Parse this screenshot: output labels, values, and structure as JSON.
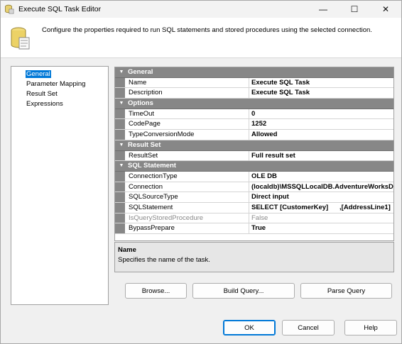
{
  "window": {
    "title": "Execute SQL Task Editor",
    "controls": {
      "minimize": "—",
      "maximize": "☐",
      "close": "✕"
    }
  },
  "header": {
    "description": "Configure the properties required to run SQL statements and stored procedures using the selected connection."
  },
  "nav": {
    "items": [
      {
        "label": "General",
        "selected": true
      },
      {
        "label": "Parameter Mapping",
        "selected": false
      },
      {
        "label": "Result Set",
        "selected": false
      },
      {
        "label": "Expressions",
        "selected": false
      }
    ]
  },
  "grid": {
    "general": {
      "category": "General",
      "name_label": "Name",
      "name_value": "Execute SQL Task",
      "description_label": "Description",
      "description_value": "Execute SQL Task"
    },
    "options": {
      "category": "Options",
      "timeout_label": "TimeOut",
      "timeout_value": "0",
      "codepage_label": "CodePage",
      "codepage_value": "1252",
      "typeconv_label": "TypeConversionMode",
      "typeconv_value": "Allowed"
    },
    "resultset": {
      "category": "Result Set",
      "resultset_label": "ResultSet",
      "resultset_value": "Full result set"
    },
    "sql": {
      "category": "SQL Statement",
      "conntype_label": "ConnectionType",
      "conntype_value": "OLE DB",
      "connection_label": "Connection",
      "connection_value": "(localdb)\\MSSQLLocalDB.AdventureWorksDW",
      "sourcetype_label": "SQLSourceType",
      "sourcetype_value": "Direct input",
      "statement_label": "SQLStatement",
      "statement_value": "SELECT [CustomerKey]      ,[AddressLine1]       ",
      "isstored_label": "IsQueryStoredProcedure",
      "isstored_value": "False",
      "bypass_label": "BypassPrepare",
      "bypass_value": "True"
    }
  },
  "description_panel": {
    "title": "Name",
    "text": "Specifies the name of the task."
  },
  "buttons": {
    "browse": "Browse...",
    "build_query": "Build Query...",
    "parse_query": "Parse Query",
    "ok": "OK",
    "cancel": "Cancel",
    "help": "Help"
  },
  "colors": {
    "category_bg": "#878787",
    "selection": "#0078d7",
    "window_bg": "#f0f0f0"
  }
}
